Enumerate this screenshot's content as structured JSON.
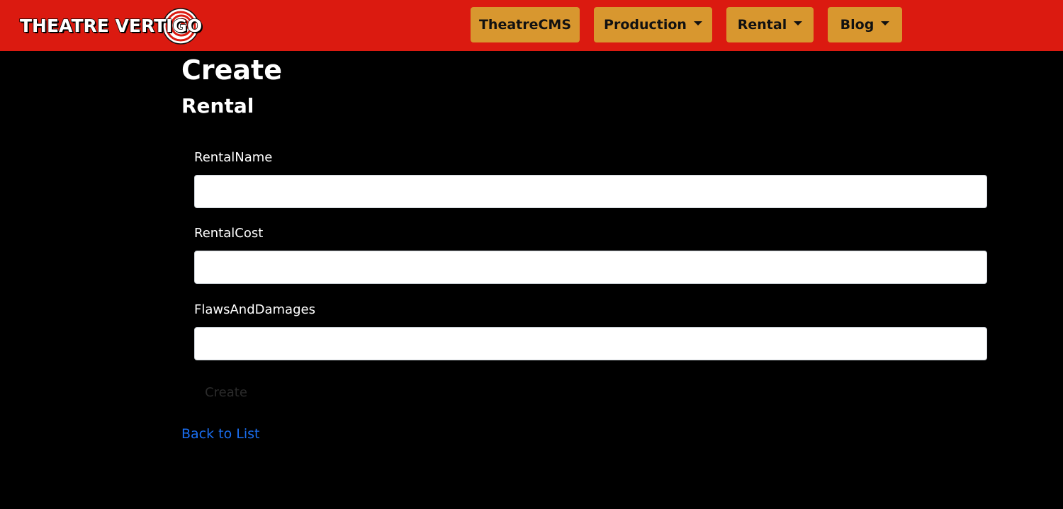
{
  "brand": {
    "logo_text": "THEATRE VERTIGO",
    "colors": {
      "navbar": "#db1a10",
      "nav_button": "#d8972f",
      "link": "#1a6ef0",
      "background": "#000000"
    }
  },
  "nav": {
    "items": [
      {
        "label": "TheatreCMS",
        "dropdown": false
      },
      {
        "label": "Production",
        "dropdown": true
      },
      {
        "label": "Rental",
        "dropdown": true
      },
      {
        "label": "Blog",
        "dropdown": true
      }
    ]
  },
  "page": {
    "title": "Create",
    "subtitle": "Rental"
  },
  "form": {
    "fields": [
      {
        "label": "RentalName",
        "value": "",
        "placeholder": ""
      },
      {
        "label": "RentalCost",
        "value": "",
        "placeholder": ""
      },
      {
        "label": "FlawsAndDamages",
        "value": "",
        "placeholder": ""
      }
    ],
    "submit_label": "Create"
  },
  "links": {
    "back_label": "Back to List"
  }
}
